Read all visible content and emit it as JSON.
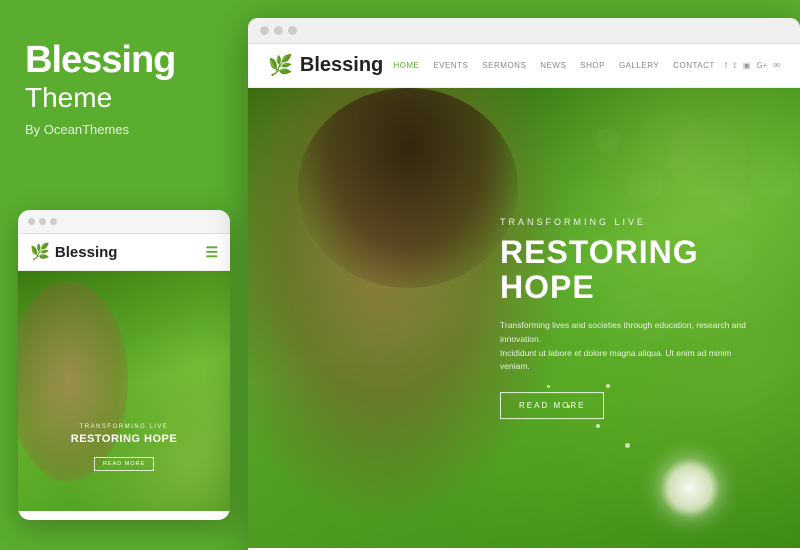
{
  "left": {
    "title": "Blessing",
    "subtitle": "Theme",
    "by": "By OceanThemes"
  },
  "mobile": {
    "logo": "Blessing",
    "tagline": "TRANSFORMING LIVE",
    "heading": "RESTORING HOPE",
    "cta": "READ MORE"
  },
  "desktop": {
    "logo": "Blessing",
    "nav": {
      "links": [
        {
          "label": "HOME",
          "active": true
        },
        {
          "label": "EVENTS",
          "active": false
        },
        {
          "label": "SERMONS",
          "active": false
        },
        {
          "label": "NEWS",
          "active": false
        },
        {
          "label": "SHOP",
          "active": false
        },
        {
          "label": "GALLERY",
          "active": false
        },
        {
          "label": "CONTACT",
          "active": false
        }
      ]
    },
    "hero": {
      "tagline": "TRANSFORMING LIVE",
      "title": "RESTORING HOPE",
      "desc_line1": "Transforming lives and societies through education, research and innovation.",
      "desc_line2": "Incididunt ut labore et dolore magna aliqua. Ut enim ad minim veniam.",
      "cta": "READ MORE"
    }
  },
  "colors": {
    "green": "#5aad2e",
    "white": "#ffffff",
    "dark": "#222222"
  }
}
